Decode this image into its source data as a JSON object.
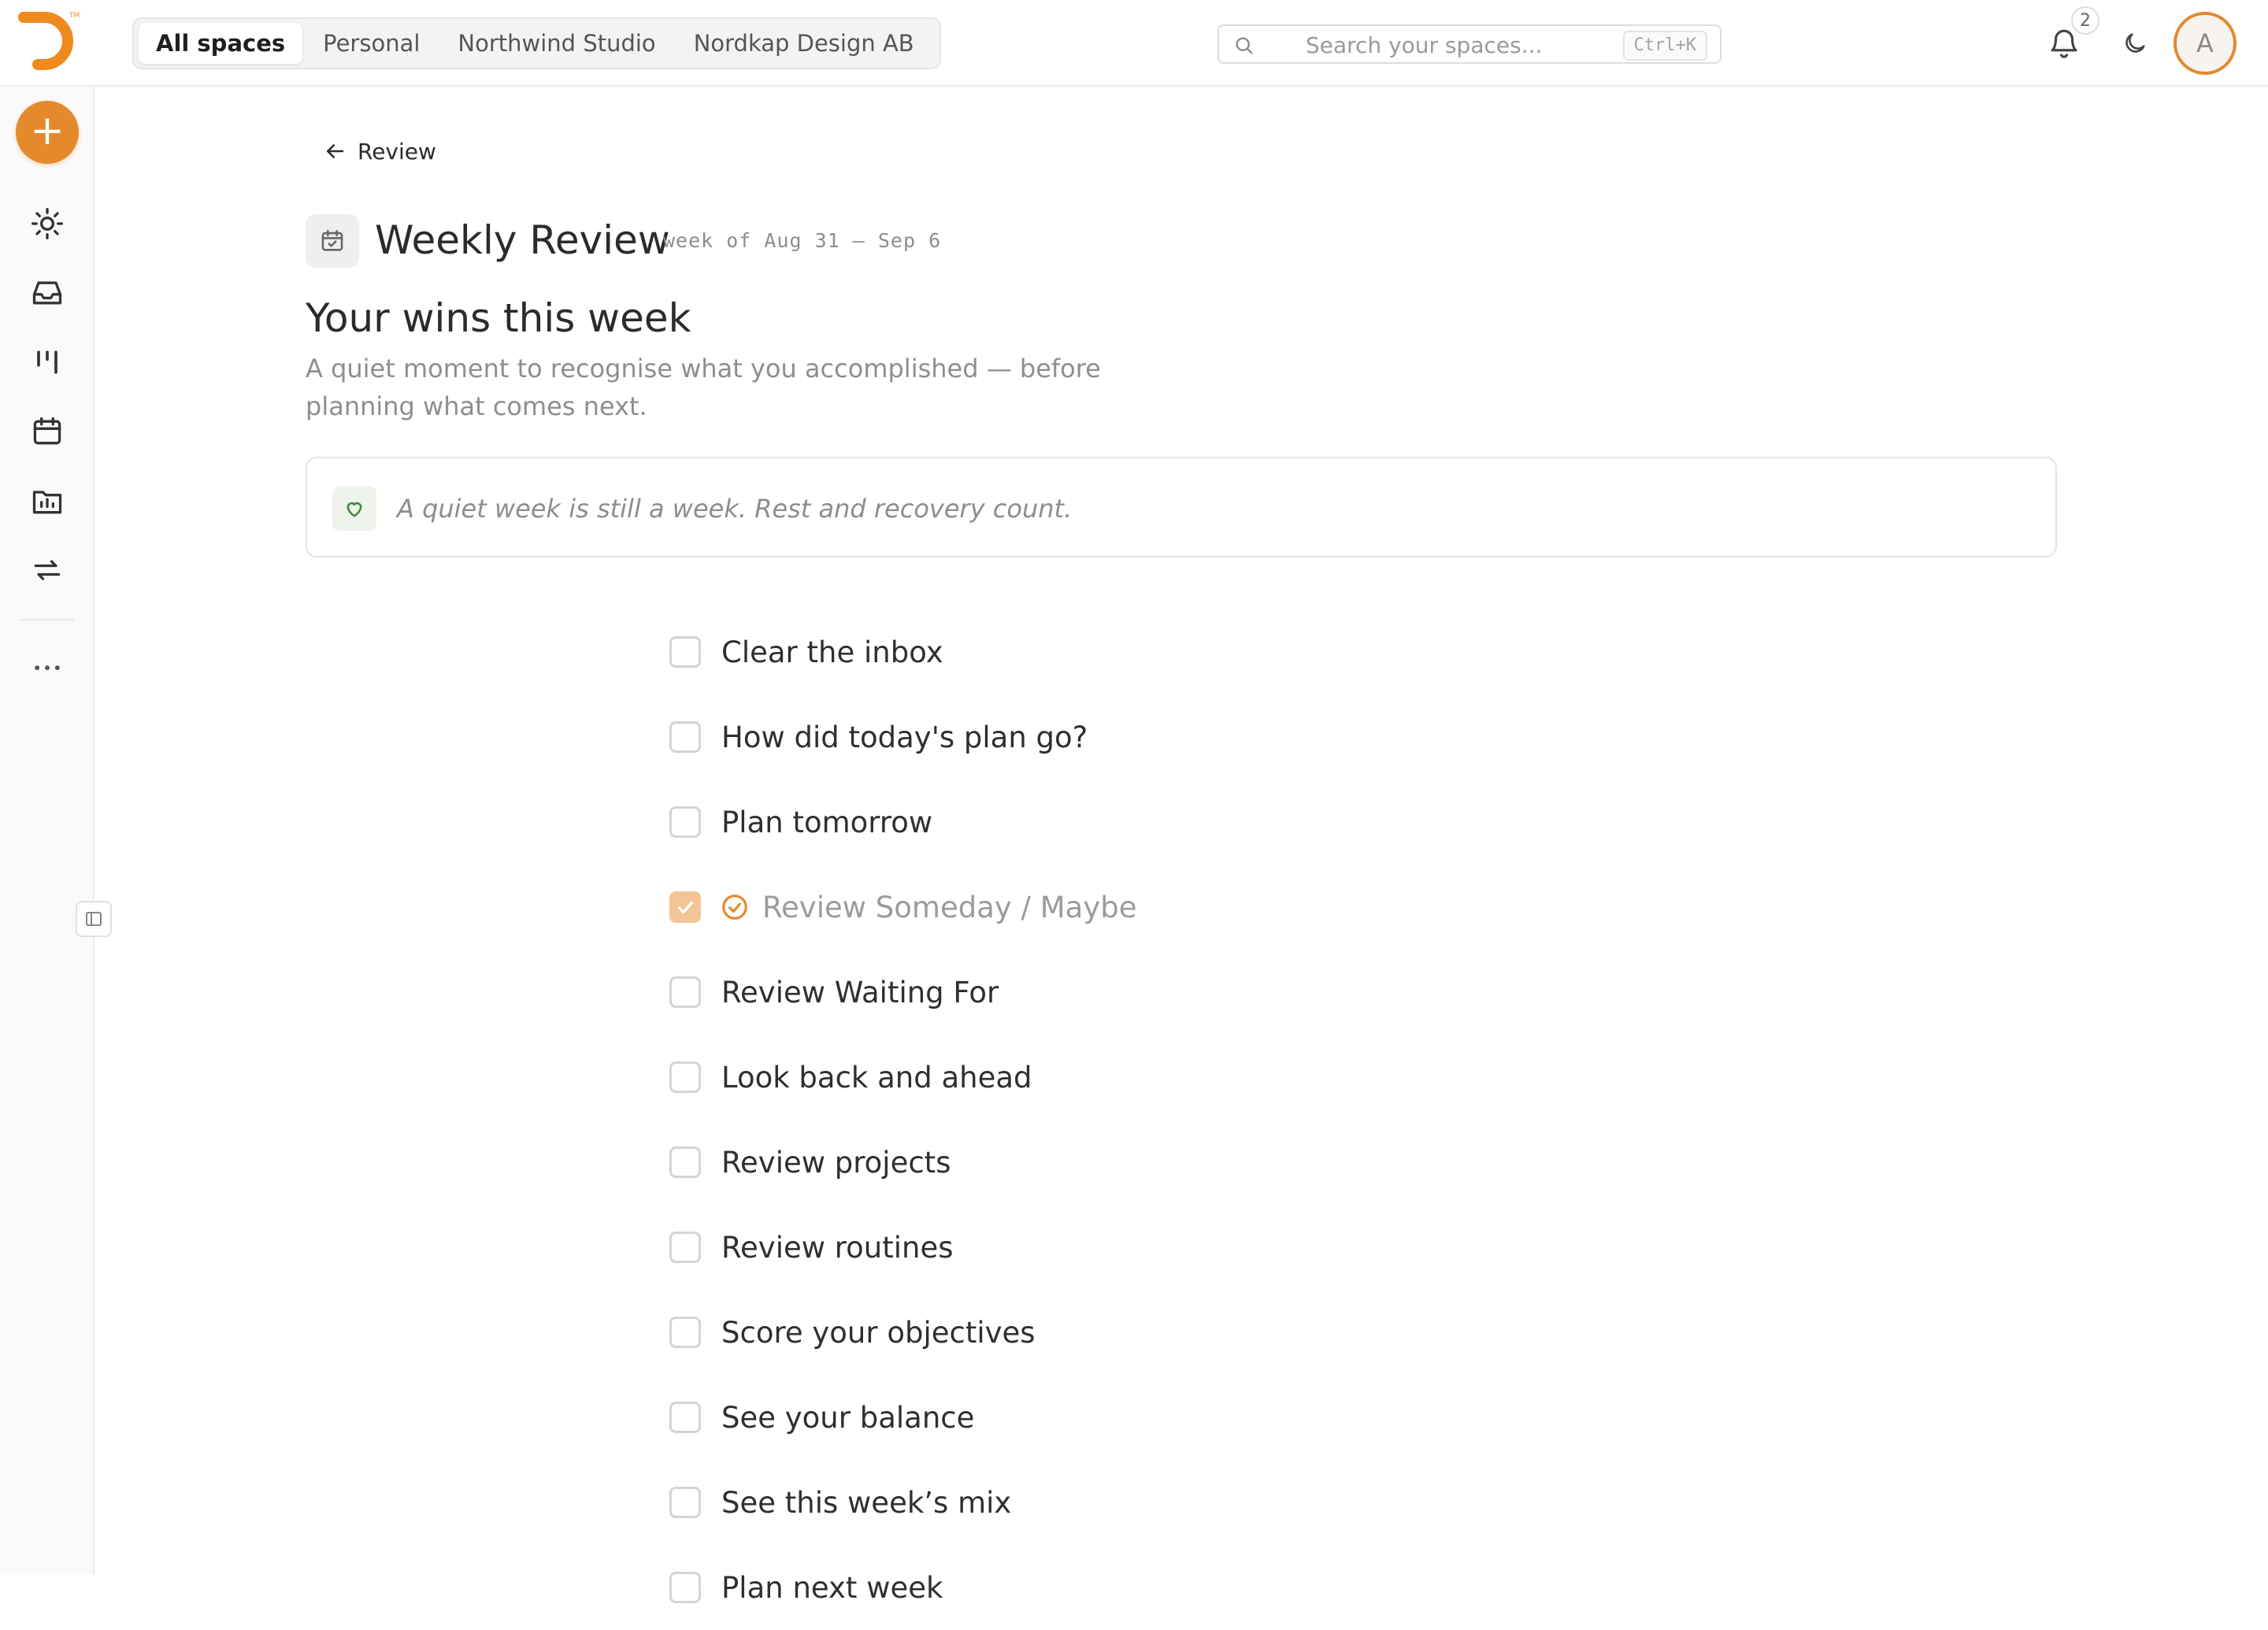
{
  "app": {
    "accent_color": "#e58a2c",
    "logo_icon": "brand-logo-icon",
    "trademark": "TM"
  },
  "header": {
    "spaces": [
      {
        "label": "All spaces",
        "active": true
      },
      {
        "label": "Personal",
        "active": false
      },
      {
        "label": "Northwind Studio",
        "active": false
      },
      {
        "label": "Nordkap Design AB",
        "active": false
      }
    ],
    "search": {
      "placeholder": "Search your spaces...",
      "value": "",
      "shortcut": "Ctrl+K"
    },
    "notifications": {
      "count": "2"
    },
    "avatar_initial": "A"
  },
  "sidebar": {
    "add_label": "+",
    "items": [
      {
        "name": "today",
        "icon": "sun-icon"
      },
      {
        "name": "inbox",
        "icon": "inbox-icon"
      },
      {
        "name": "board",
        "icon": "columns-icon"
      },
      {
        "name": "calendar",
        "icon": "calendar-icon"
      },
      {
        "name": "projects",
        "icon": "folder-chart-icon"
      },
      {
        "name": "routines",
        "icon": "repeat-icon"
      },
      {
        "name": "more",
        "icon": "more-icon"
      }
    ]
  },
  "page": {
    "back_label": "Review",
    "title": "Weekly Review",
    "week_range": "week of Aug 31 – Sep 6",
    "wins_heading": "Your wins this week",
    "wins_subtitle": "A quiet moment to recognise what you accomplished — before planning what comes next.",
    "quiet_message": "A quiet week is still a week. Rest and recovery count.",
    "checklist": [
      {
        "label": "Clear the inbox",
        "done": false
      },
      {
        "label": "How did today's plan go?",
        "done": false
      },
      {
        "label": "Plan tomorrow",
        "done": false
      },
      {
        "label": "Review Someday / Maybe",
        "done": true
      },
      {
        "label": "Review Waiting For",
        "done": false
      },
      {
        "label": "Look back and ahead",
        "done": false
      },
      {
        "label": "Review projects",
        "done": false
      },
      {
        "label": "Review routines",
        "done": false
      },
      {
        "label": "Score your objectives",
        "done": false
      },
      {
        "label": "See your balance",
        "done": false
      },
      {
        "label": "See this week’s mix",
        "done": false
      },
      {
        "label": "Plan next week",
        "done": false
      }
    ]
  }
}
